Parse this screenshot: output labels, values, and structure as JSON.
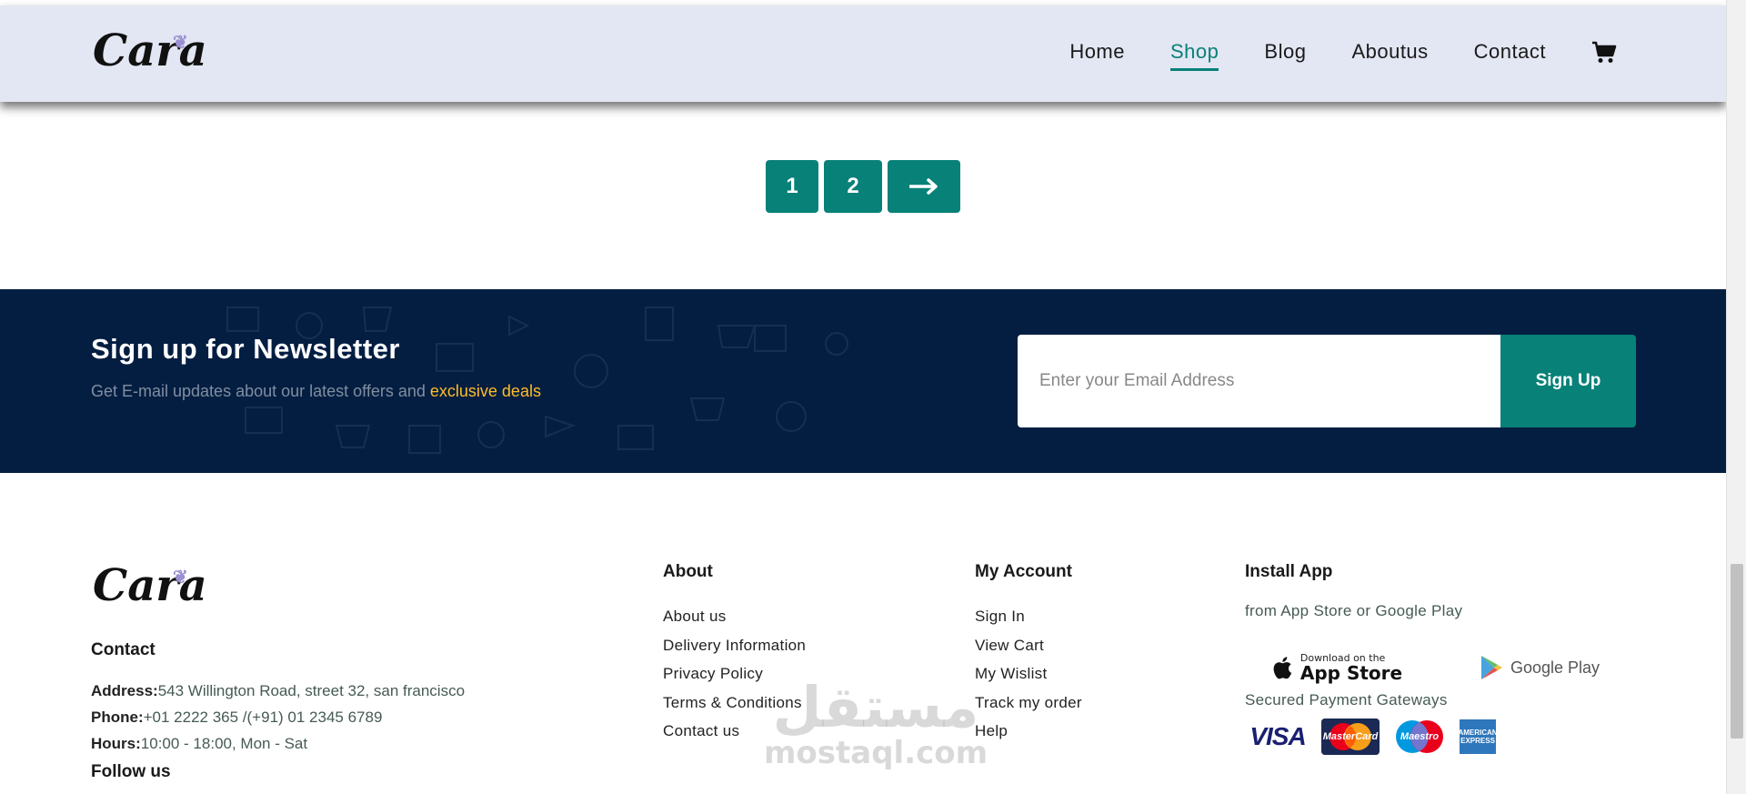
{
  "header": {
    "logo_text": "Cara",
    "nav": [
      {
        "label": "Home",
        "active": false
      },
      {
        "label": "Shop",
        "active": true
      },
      {
        "label": "Blog",
        "active": false
      },
      {
        "label": "Aboutus",
        "active": false
      },
      {
        "label": "Contact",
        "active": false
      }
    ],
    "cart_icon": "shopping-cart-icon"
  },
  "pagination": {
    "pages": [
      "1",
      "2"
    ],
    "next_icon": "arrow-right-icon"
  },
  "newsletter": {
    "title": "Sign up for Newsletter",
    "subtitle_prefix": "Get E-mail updates about our latest offers and ",
    "subtitle_highlight": "exclusive deals",
    "email_placeholder": "Enter your Email Address",
    "button_label": "Sign Up",
    "colors": {
      "background": "#041e42",
      "highlight": "#ffbd27",
      "button": "#088178"
    }
  },
  "footer": {
    "logo_text": "Cara",
    "contact": {
      "heading": "Contact",
      "address_label": "Address:",
      "address_value": "543 Willington Road, street 32, san francisco",
      "phone_label": "Phone:",
      "phone_value": "+01 2222 365 /(+91) 01 2345 6789",
      "hours_label": "Hours:",
      "hours_value": "10:00 - 18:00, Mon - Sat",
      "follow_heading": "Follow us"
    },
    "about": {
      "heading": "About",
      "links": [
        "About us",
        "Delivery Information",
        "Privacy Policy",
        "Terms & Conditions",
        "Contact us"
      ]
    },
    "account": {
      "heading": "My Account",
      "links": [
        "Sign In",
        "View Cart",
        "My Wislist",
        "Track my order",
        "Help"
      ]
    },
    "app": {
      "heading": "Install App",
      "subtext": "from App Store or Google Play",
      "appstore_small": "Download on the",
      "appstore_big": "App Store",
      "googleplay": "Google Play",
      "payment_heading": "Secured Payment Gateways",
      "payments": [
        "VISA",
        "MasterCard",
        "Maestro",
        "AMERICAN EXPRESS"
      ]
    }
  },
  "watermark": {
    "arabic": "مستقل",
    "latin": "mostaql.com"
  },
  "accent_color": "#088178"
}
